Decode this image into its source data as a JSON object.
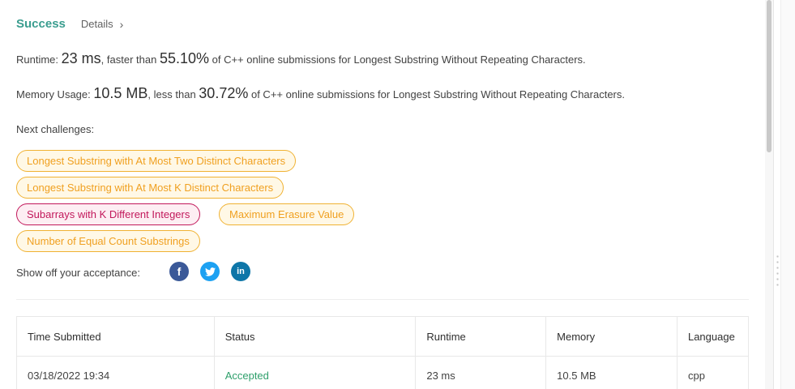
{
  "status": {
    "label": "Success",
    "details_label": "Details",
    "details_chevron": "›"
  },
  "runtime": {
    "prefix": "Runtime: ",
    "value": "23 ms",
    "middle": ", faster than ",
    "percent": "55.10%",
    "suffix": " of C++ online submissions for Longest Substring Without Repeating Characters."
  },
  "memory": {
    "prefix": "Memory Usage: ",
    "value": "10.5 MB",
    "middle": ", less than ",
    "percent": "30.72%",
    "suffix": " of C++ online submissions for Longest Substring Without Repeating Characters."
  },
  "next_challenges": {
    "label": "Next challenges:",
    "items": [
      {
        "label": "Longest Substring with At Most Two Distinct Characters",
        "difficulty": "medium"
      },
      {
        "label": "Longest Substring with At Most K Distinct Characters",
        "difficulty": "medium"
      },
      {
        "label": "Subarrays with K Different Integers",
        "difficulty": "hard"
      },
      {
        "label": "Maximum Erasure Value",
        "difficulty": "medium"
      },
      {
        "label": "Number of Equal Count Substrings",
        "difficulty": "medium"
      }
    ]
  },
  "share": {
    "label": "Show off your acceptance:",
    "icons": [
      "facebook-icon",
      "twitter-icon",
      "linkedin-icon"
    ],
    "facebook_glyph": "f",
    "linkedin_glyph": "in"
  },
  "table": {
    "columns": [
      "Time Submitted",
      "Status",
      "Runtime",
      "Memory",
      "Language"
    ],
    "rows": [
      [
        "03/18/2022 19:34",
        "Accepted",
        "23 ms",
        "10.5 MB",
        "cpp"
      ]
    ]
  },
  "colors": {
    "success": "#3a9d8f",
    "accepted": "#2e9f6b",
    "medium_tag": "#f0a020",
    "hard_tag": "#c2185b",
    "facebook": "#3b5998",
    "twitter": "#1da1f2",
    "linkedin": "#0e76a8"
  }
}
